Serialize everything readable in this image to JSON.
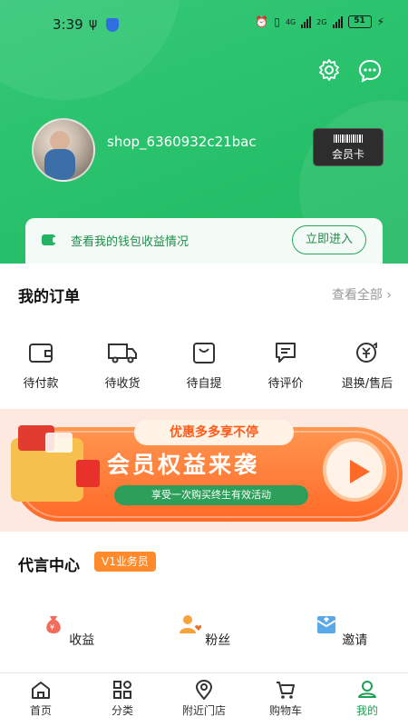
{
  "status_bar": {
    "time": "3:39",
    "battery": "51",
    "signal1": "4G",
    "signal2": "2G"
  },
  "header": {
    "username": "shop_6360932c21bac",
    "member_card_label": "会员卡",
    "wallet_text": "查看我的钱包收益情况",
    "wallet_button": "立即进入"
  },
  "orders": {
    "title": "我的订单",
    "view_all": "查看全部",
    "items": [
      {
        "label": "待付款",
        "icon": "wallet-icon"
      },
      {
        "label": "待收货",
        "icon": "truck-icon"
      },
      {
        "label": "待自提",
        "icon": "bag-icon"
      },
      {
        "label": "待评价",
        "icon": "comment-icon"
      },
      {
        "label": "退换/售后",
        "icon": "refund-icon"
      }
    ]
  },
  "banner": {
    "tag": "优惠多多享不停",
    "headline": "会员权益来袭",
    "subline": "享受一次购买终生有效活动"
  },
  "spokesperson": {
    "title": "代言中心",
    "badge": "V1业务员",
    "items": [
      {
        "label": "收益",
        "icon": "money-bag-icon"
      },
      {
        "label": "粉丝",
        "icon": "fans-icon"
      },
      {
        "label": "邀请",
        "icon": "invite-icon"
      }
    ]
  },
  "tabbar": {
    "items": [
      {
        "label": "首页",
        "icon": "home-icon"
      },
      {
        "label": "分类",
        "icon": "category-icon"
      },
      {
        "label": "附近门店",
        "icon": "location-icon"
      },
      {
        "label": "购物车",
        "icon": "cart-icon"
      },
      {
        "label": "我的",
        "icon": "profile-icon",
        "active": true
      }
    ]
  },
  "colors": {
    "brand_green": "#27c06a",
    "active_tab": "#1f9f53",
    "badge_orange": "#ff8a2b",
    "banner_orange": "#ff6a28"
  }
}
